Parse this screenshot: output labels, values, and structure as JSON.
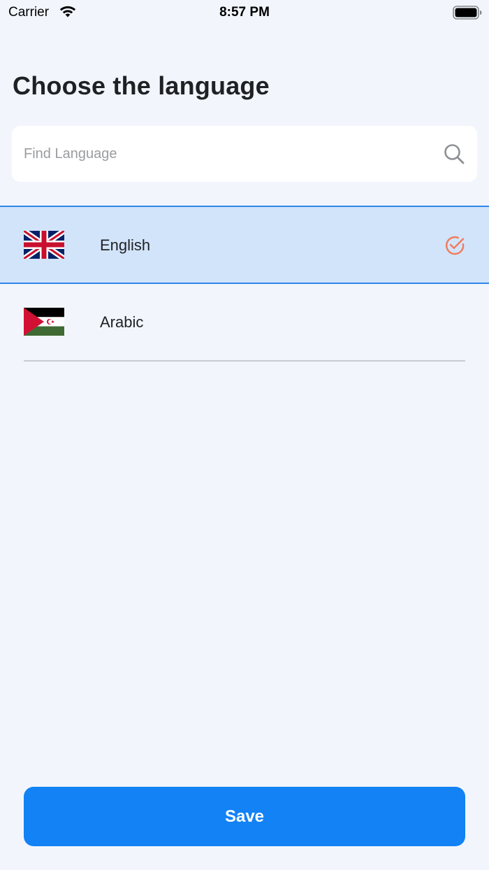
{
  "status_bar": {
    "carrier": "Carrier",
    "time": "8:57 PM",
    "wifi_icon": "wifi-icon",
    "battery_icon": "battery-full-icon"
  },
  "title": "Choose the language",
  "search": {
    "placeholder": "Find Language",
    "value": "",
    "icon": "search-icon"
  },
  "languages": [
    {
      "label": "English",
      "flag_icon": "uk-flag-icon",
      "selected": true
    },
    {
      "label": "Arabic",
      "flag_icon": "sahrawi-flag-icon",
      "selected": false
    }
  ],
  "check_icon": "check-circle-icon",
  "save_label": "Save",
  "colors": {
    "background": "#f2f6fc",
    "accent": "#1282f5",
    "selected_row": "#d2e4fa",
    "selected_border": "#2f86e9",
    "check": "#f07a5c"
  }
}
